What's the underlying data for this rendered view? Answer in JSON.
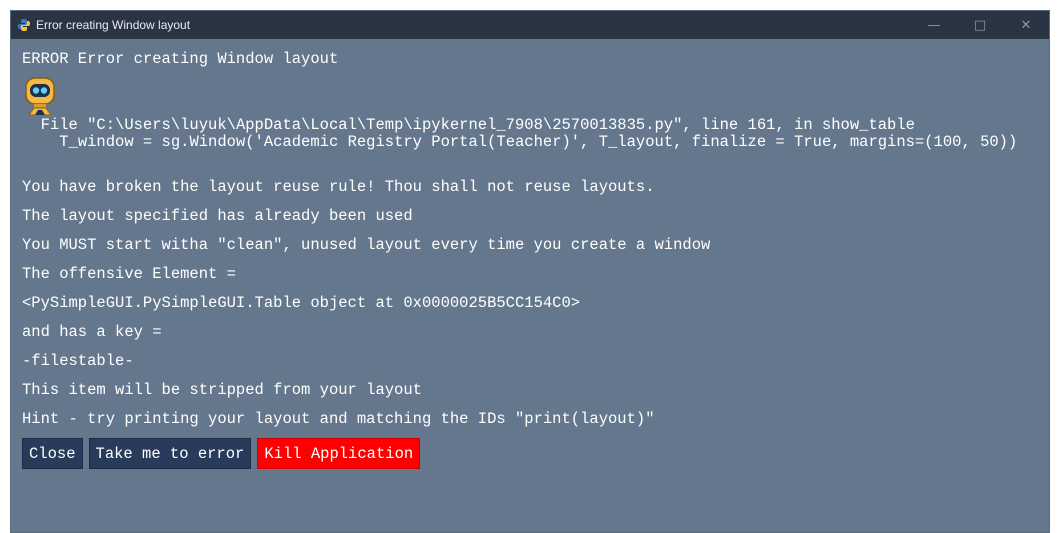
{
  "window": {
    "title": "Error creating Window layout",
    "controls": {
      "minimize": "—",
      "maximize": "□",
      "close": "✕"
    }
  },
  "content": {
    "heading": "ERROR Error creating Window layout",
    "traceback": [
      "  File \"C:\\Users\\luyuk\\AppData\\Local\\Temp\\ipykernel_7908\\2570013835.py\", line 161, in show_table",
      "    T_window = sg.Window('Academic Registry Portal(Teacher)', T_layout, finalize = True, margins=(100, 50))"
    ],
    "messages": [
      "You have broken the layout reuse rule! Thou shall not reuse layouts.",
      "The layout specified has already been used",
      "You MUST start witha \"clean\", unused layout every time you create a window",
      "The offensive Element =",
      "<PySimpleGUI.PySimpleGUI.Table object at 0x0000025B5CC154C0>",
      "and has a key =",
      "-filestable-",
      "This item will be stripped from your layout",
      "Hint - try printing your layout and matching the IDs \"print(layout)\""
    ]
  },
  "buttons": {
    "close": "Close",
    "goto_error": "Take me to error",
    "kill": "Kill Application"
  },
  "colors": {
    "background": "#64778d",
    "titlebar": "#2a3442",
    "button": "#283b5b",
    "kill_button": "#ff0000"
  },
  "icons": {
    "app": "python-icon",
    "mascot": "robot-mascot-icon"
  }
}
